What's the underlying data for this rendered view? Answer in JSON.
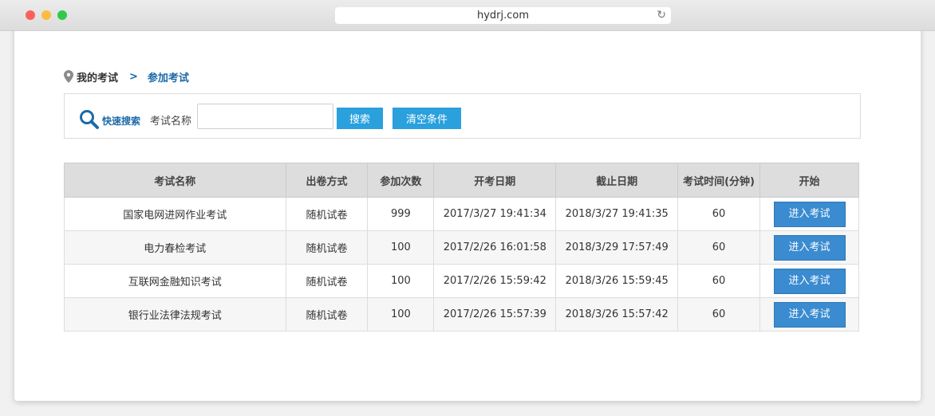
{
  "browser": {
    "url": "hydrj.com"
  },
  "breadcrumb": {
    "home": "我的考试",
    "separator": ">",
    "current": "参加考试"
  },
  "search": {
    "quick_label": "快速搜索",
    "field_label": "考试名称",
    "input_value": "",
    "search_button": "搜索",
    "clear_button": "清空条件"
  },
  "table": {
    "headers": [
      "考试名称",
      "出卷方式",
      "参加次数",
      "开考日期",
      "截止日期",
      "考试时间(分钟)",
      "开始"
    ],
    "rows": [
      {
        "name": "国家电网进网作业考试",
        "mode": "随机试卷",
        "count": "999",
        "start": "2017/3/27 19:41:34",
        "end": "2018/3/27 19:41:35",
        "duration": "60",
        "action": "进入考试"
      },
      {
        "name": "电力春检考试",
        "mode": "随机试卷",
        "count": "100",
        "start": "2017/2/26 16:01:58",
        "end": "2018/3/29 17:57:49",
        "duration": "60",
        "action": "进入考试"
      },
      {
        "name": "互联网金融知识考试",
        "mode": "随机试卷",
        "count": "100",
        "start": "2017/2/26 15:59:42",
        "end": "2018/3/26 15:59:45",
        "duration": "60",
        "action": "进入考试"
      },
      {
        "name": "银行业法律法规考试",
        "mode": "随机试卷",
        "count": "100",
        "start": "2017/2/26 15:57:39",
        "end": "2018/3/26 15:57:42",
        "duration": "60",
        "action": "进入考试"
      }
    ]
  },
  "colors": {
    "accent": "#2aa0dd",
    "button": "#3a8bd0",
    "link": "#1c6aa8"
  }
}
